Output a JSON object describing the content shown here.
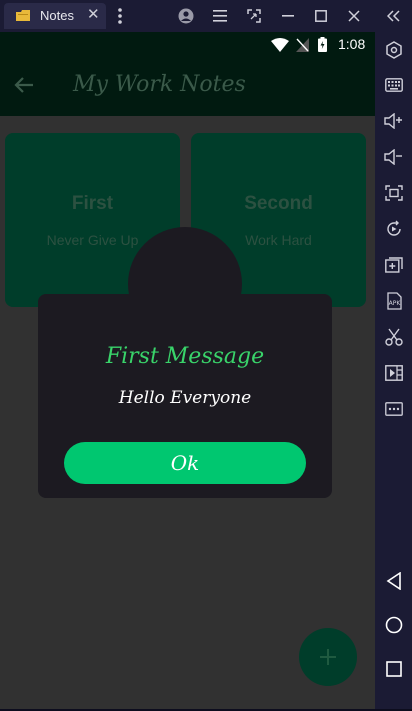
{
  "window": {
    "tab_label": "Notes",
    "tab_close": "✕"
  },
  "status": {
    "time": "1:08"
  },
  "app": {
    "title": "My Work Notes"
  },
  "notes": [
    {
      "title": "First",
      "subtitle": "Never Give Up"
    },
    {
      "title": "Second",
      "subtitle": "Work Hard"
    }
  ],
  "dialog": {
    "title": "First Message",
    "message": "Hello Everyone",
    "button_label": "Ok"
  },
  "fab": {
    "label": "+"
  },
  "colors": {
    "accent": "#00c770",
    "dialog_title": "#39d36a",
    "card_bg": "#003d2a",
    "app_bar": "#011a10",
    "emulator_chrome": "#1b1b34"
  },
  "icons": {
    "titlebar": [
      "menu-dots-icon",
      "account-icon",
      "hamburger-icon",
      "expand-icon",
      "minimize-icon",
      "maximize-icon",
      "close-icon",
      "collapse-sidebar-icon"
    ],
    "sidebar": [
      "settings-icon",
      "keyboard-icon",
      "volume-up-icon",
      "volume-down-icon",
      "screenshot-icon",
      "rotate-icon",
      "add-icon",
      "apk-icon",
      "scissors-icon",
      "media-icon",
      "more-icon",
      "android-back-icon",
      "android-home-icon",
      "android-recents-icon"
    ]
  }
}
